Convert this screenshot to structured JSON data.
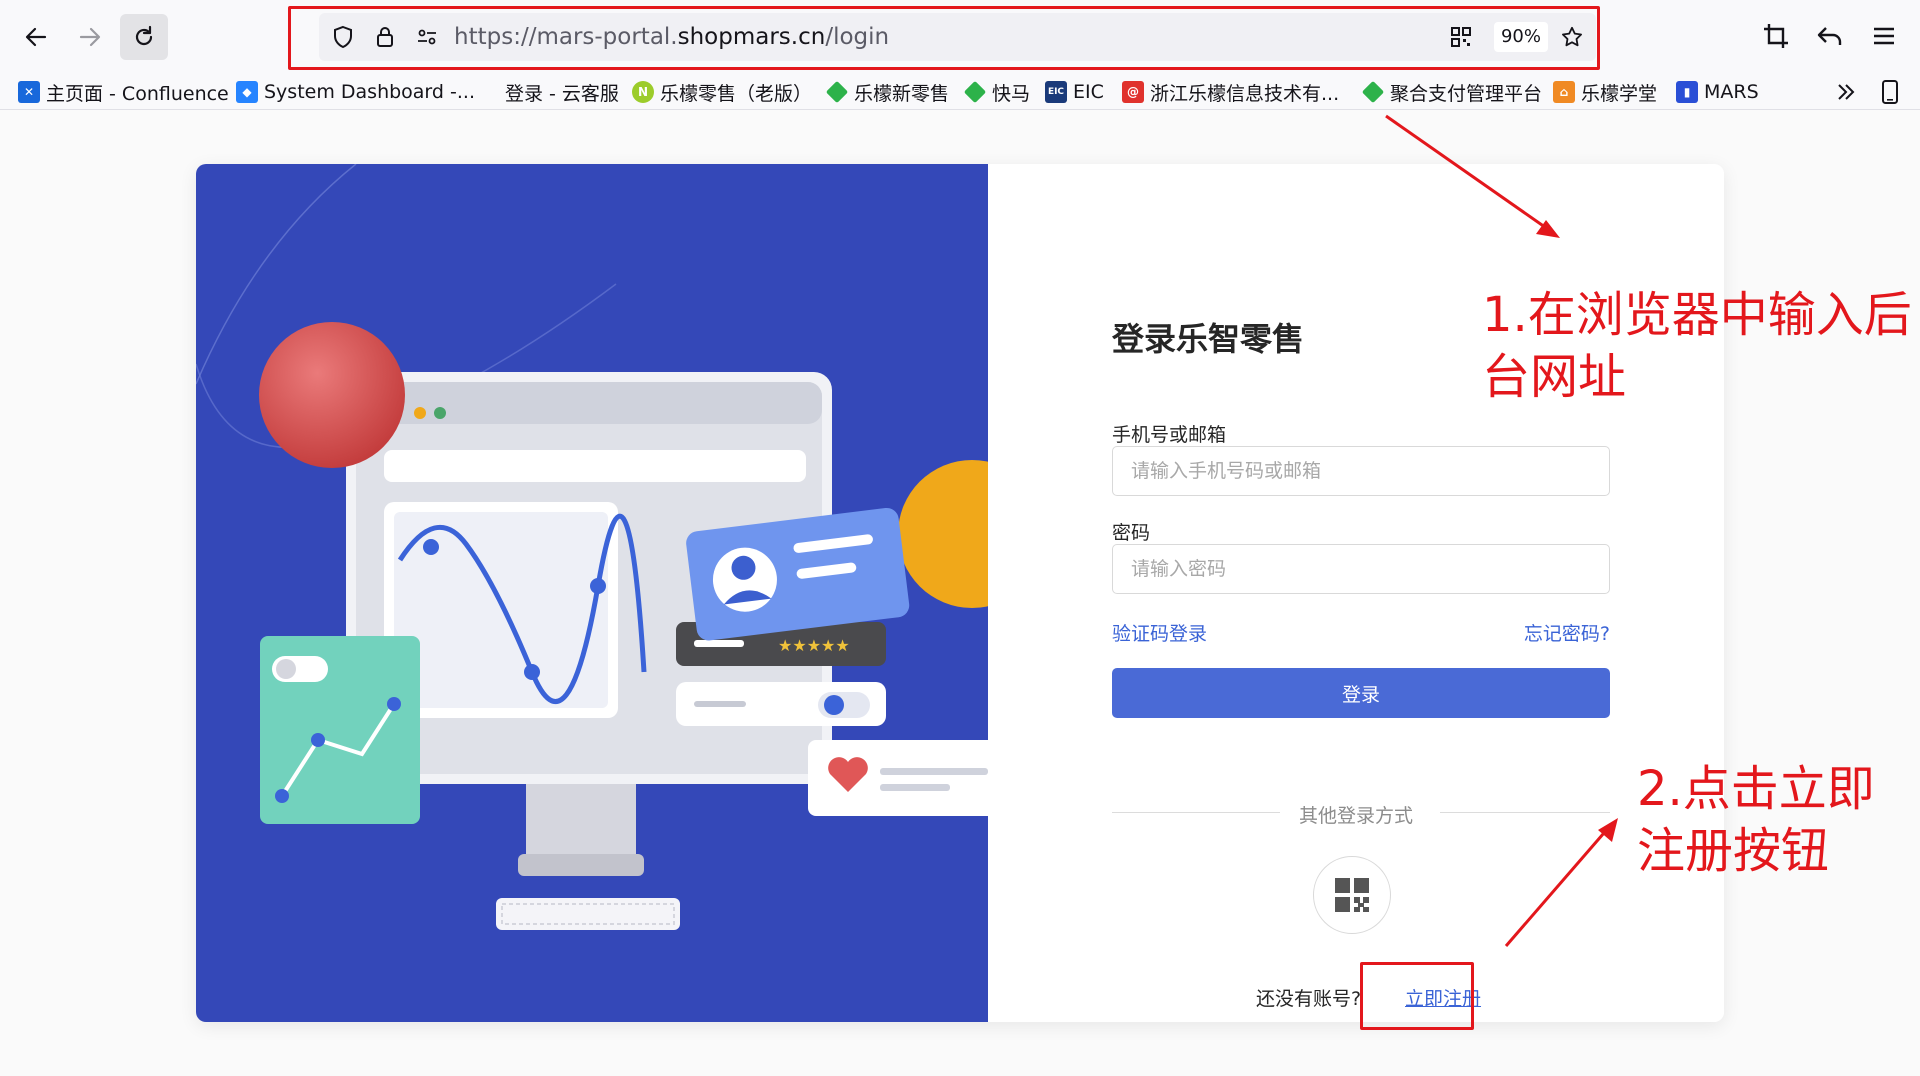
{
  "browser": {
    "url_prefix": "https://mars-portal.",
    "url_domain": "shopmars.cn",
    "url_path": "/login",
    "zoom": "90%"
  },
  "bookmarks": [
    {
      "label": "主页面 - Confluence",
      "icon": "confluence-icon",
      "color": "#1868db"
    },
    {
      "label": "System Dashboard -...",
      "icon": "jira-icon",
      "color": "#2684ff"
    },
    {
      "label": "登录 - 云客服",
      "icon": "",
      "color": ""
    },
    {
      "label": "乐檬零售（老版）",
      "icon": "n-circle-icon",
      "color": "#9ccc2b"
    },
    {
      "label": "乐檬新零售",
      "icon": "green-diamond-icon",
      "color": "#2db24a"
    },
    {
      "label": "快马",
      "icon": "green-diamond-icon",
      "color": "#2db24a"
    },
    {
      "label": "EIC",
      "icon": "eic-icon",
      "color": "#1a3a7a"
    },
    {
      "label": "浙江乐檬信息技术有...",
      "icon": "at-icon",
      "color": "#e0322d"
    },
    {
      "label": "聚合支付管理平台",
      "icon": "green-diamond-icon",
      "color": "#2db24a"
    },
    {
      "label": "乐檬学堂",
      "icon": "orange-house-icon",
      "color": "#f08a24"
    },
    {
      "label": "MARS",
      "icon": "mars-icon",
      "color": "#2a4fd6"
    }
  ],
  "login": {
    "title": "登录乐智零售",
    "phone_label": "手机号或邮箱",
    "phone_placeholder": "请输入手机号码或邮箱",
    "password_label": "密码",
    "password_placeholder": "请输入密码",
    "sms_login": "验证码登录",
    "forgot_password": "忘记密码?",
    "submit": "登录",
    "other_methods": "其他登录方式",
    "no_account": "还没有账号?",
    "register": "立即注册"
  },
  "annotations": {
    "step1": "1.在浏览器中输入后台网址",
    "step2": "2.点击立即注册按钮",
    "color": "#e3171c"
  },
  "colors": {
    "hero_bg": "#3448b8",
    "primary": "#4a6ad6",
    "link": "#3a63d6"
  }
}
